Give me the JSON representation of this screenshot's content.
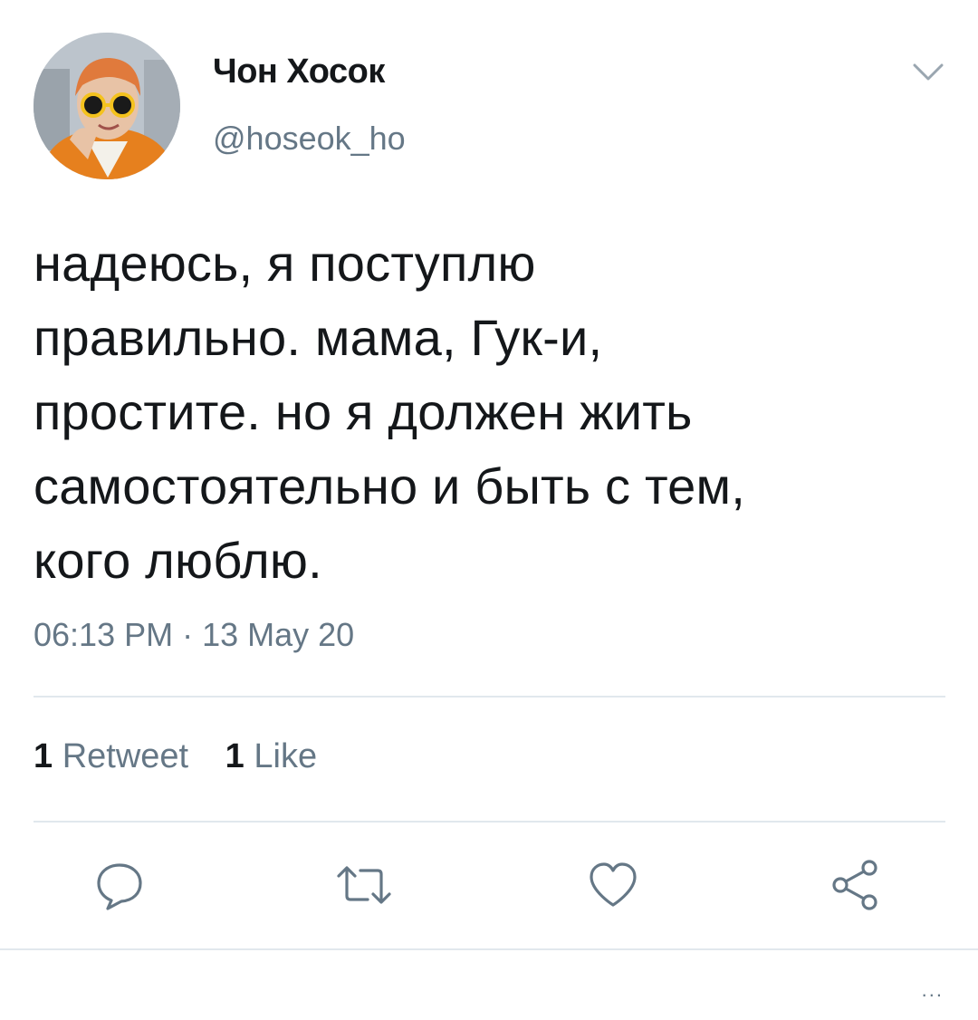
{
  "tweet": {
    "author_name": "Чон Хосок",
    "author_handle": "@hoseok_ho",
    "text_lines": [
      "надеюсь, я поступлю",
      "правильно. мама, Гук-и,",
      "простите. но я должен жить",
      "самостоятельно и быть с тем,",
      "кого люблю."
    ],
    "timestamp": "06:13 PM · 13 May 20",
    "retweet_count": "1",
    "retweet_label": "Retweet",
    "like_count": "1",
    "like_label": "Like"
  },
  "icons": {
    "caret": "chevron-down-icon",
    "reply": "reply-icon",
    "retweet": "retweet-icon",
    "like": "heart-icon",
    "share": "share-icon",
    "more": "more-dots-icon"
  },
  "more_dots": "...",
  "colors": {
    "text": "#14171a",
    "secondary": "#657786",
    "separator": "#e1e8ed"
  }
}
